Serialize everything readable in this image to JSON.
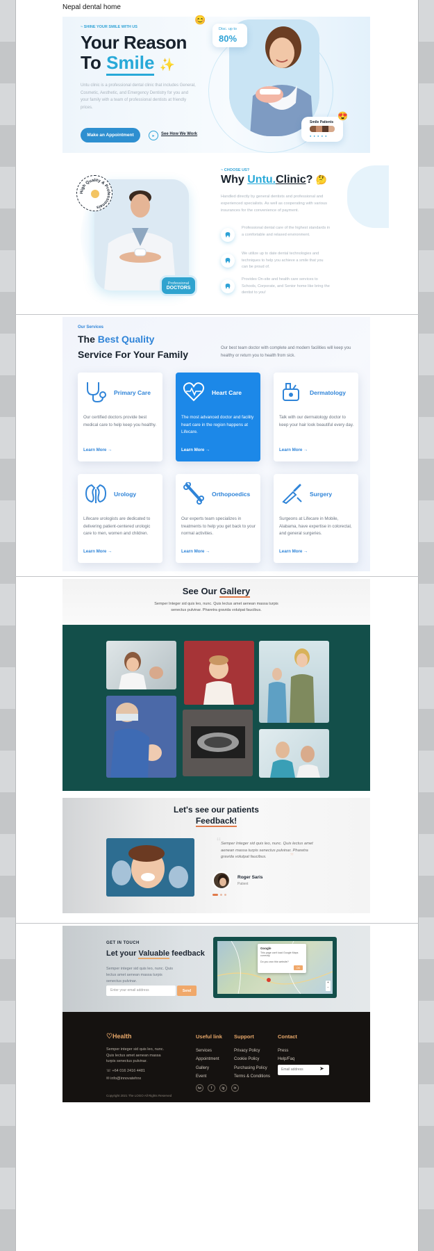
{
  "page": {
    "title": "Nepal dental home"
  },
  "hero": {
    "eyebrow": "~ SHINE YOUR SMILE WITH US",
    "headline_line1": "Your Reason",
    "headline_to": "To",
    "headline_smile": "Smile",
    "headline_sparkle": "✨",
    "description": "Untu clinic is a professional dental clinic that includes General, Cosmetic, Aesthetic, and Emergency Dentistry for you and your family with a team of professional dentists at friendly prices.",
    "cta_primary": "Make an Appointment",
    "cta_secondary": "See How We Work",
    "discount_label": "Disc. up to",
    "discount_value": "80%",
    "smile_patients_label": "Smile Patients",
    "smile_emoji": "😍",
    "top_emoji": "😊",
    "rating_dots": "● ● ● ● ●"
  },
  "why": {
    "badge_ring_text": "High Quality & Professionals",
    "eyebrow": "~ CHOOSE US?",
    "title_why": "Why",
    "title_brand": "Untu.",
    "title_clinic": "Clinic",
    "title_q": "?",
    "title_emoji": "🤔",
    "intro": "Handled directly by general dentists and professional and experienced specialists. As well as cooperating with various insurances for the convenience of payment.",
    "features": [
      {
        "text": "Professional dental care of the highest standards in a comfortable and relaxed environment."
      },
      {
        "text": "We utilize up to date dental technologies and techniques to help you achieve a smile that you can be proud of."
      },
      {
        "text": "Provides On-site and health care services to Schools, Corporate, and Senior home like bring the dentist to you!"
      }
    ],
    "doctor_badge_line1": "Professional",
    "doctor_badge_line2": "DOCTORS"
  },
  "services": {
    "eyebrow": "Our Services",
    "title_the": "The",
    "title_best": "Best Quality",
    "title_line2": "Service For Your Family",
    "description": "Our best team doctor with complete and modern facilities will keep you healthy or return you to health from sick.",
    "learn_more": "Learn More →",
    "cards": [
      {
        "title": "Primary Care",
        "desc": "Our certified doctors provide best medical care to help keep you healthy.",
        "icon": "stethoscope-icon"
      },
      {
        "title": "Heart Care",
        "desc": "The most advanced doctor and facility heart care in the region happens at Lifecare.",
        "icon": "heart-pulse-icon"
      },
      {
        "title": "Dermatology",
        "desc": "Talk with our dermatology doctor to keep your hair look beautiful every day.",
        "icon": "dermatology-icon"
      },
      {
        "title": "Urology",
        "desc": "Lifecare urologists are dedicated to delivering patient-centered urologic care to men, women and children.",
        "icon": "kidney-icon"
      },
      {
        "title": "Orthopoedics",
        "desc": "Our experts team specializes in treatments to help you get back to your normal activities.",
        "icon": "bone-icon"
      },
      {
        "title": "Surgery",
        "desc": "Surgeons at Lifecare in Mobile, Alabama, have expertise in colorectal, and general surgeries.",
        "icon": "scalpel-icon"
      }
    ]
  },
  "gallery": {
    "title_see": "See Our",
    "title_gallery": "Gallery",
    "subtitle": "Semper Integer sid quis leo, nunc. Quis lectus amet aenean massa turpis senectus pulvinar. Pharetra gravida volutpat faucibus."
  },
  "feedback": {
    "title_line1": "Let's see our patients",
    "title_line2": "Feedback!",
    "quote": "Semper Integer sid quis leo, nunc. Quis lectus amet aenean massa turpis senectus pulvinar. Pharetra gravida volutpat faucibus.",
    "author_name": "Roger Saris",
    "author_role": "Patient"
  },
  "contact": {
    "eyebrow": "GET IN TOUCH",
    "title_let": "Let your",
    "title_valuable": "Valuable",
    "title_feedback": "feedback",
    "description": "Semper integer sid quis leo, nunc. Quis lectus amet aenean massa turpis senectus pulvinar.",
    "email_placeholder": "Enter your email address",
    "send_label": "Send",
    "map_popup_title": "Google",
    "map_popup_text": "This page can't load Google Maps correctly.",
    "map_popup_question": "Do you own this website?",
    "map_popup_ok": "OK"
  },
  "footer": {
    "brand": "Health",
    "about": "Semper integer sid quis leo, nunc. Quis lectus amet aenean massa turpis senectus pulvinar.",
    "phone": "+64 016 2416 4481",
    "email": "info@innovatehnx",
    "useful_title": "Useful link",
    "useful_links": [
      "Services",
      "Appointment",
      "Gallery",
      "Event"
    ],
    "support_title": "Support",
    "support_links": [
      "Privacy Policy",
      "Cookie Policy",
      "Purchasing Policy",
      "Terms & Conditions"
    ],
    "contact_title": "Contact",
    "contact_links": [
      "Press",
      "Help/Faq"
    ],
    "email_placeholder": "Email address",
    "copyright": "Copyright 2021 The LOGO All Rights Reserved",
    "social": [
      "tw",
      "f",
      "ig",
      "in"
    ]
  },
  "colors": {
    "accent": "#1c88e8",
    "brand": "#28a9d8",
    "gallery_bg": "#134f4a",
    "footer_bg": "#151210",
    "orange": "#e8a86a"
  }
}
